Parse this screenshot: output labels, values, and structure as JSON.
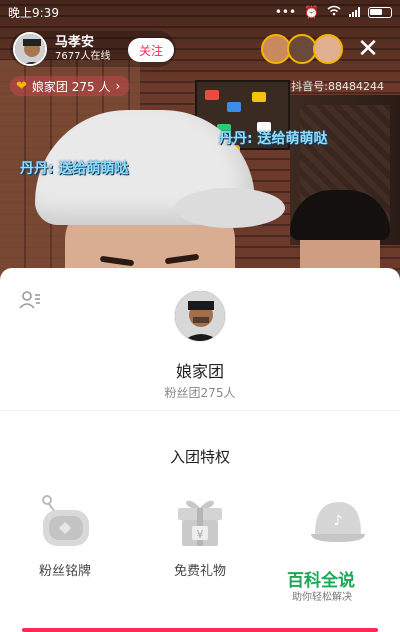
{
  "status_bar": {
    "time": "晚上9:39"
  },
  "live_header": {
    "anchor_name": "马孝安",
    "online_count": "7677人在线",
    "follow_label": "关注",
    "fan_badge": "娘家团 275 人",
    "douyin_id": "抖音号:88484244"
  },
  "danmaku": [
    {
      "text": "丹丹: 送给萌萌哒"
    },
    {
      "text": "丹丹: 送给萌萌哒"
    }
  ],
  "sheet": {
    "group_name": "娘家团",
    "group_count": "粉丝团275人",
    "section_title": "入团特权",
    "privileges": [
      {
        "label": "粉丝铭牌",
        "icon": "badge-icon"
      },
      {
        "label": "免费礼物",
        "icon": "gift-icon"
      },
      {
        "label": "",
        "icon": "cap-icon"
      }
    ]
  },
  "watermark": {
    "main": "百科全说",
    "sub": "助你轻松解决"
  },
  "colors": {
    "accent": "#fe2c55",
    "danmaku": "#8fe0ff",
    "watermark": "#1aaa55"
  }
}
